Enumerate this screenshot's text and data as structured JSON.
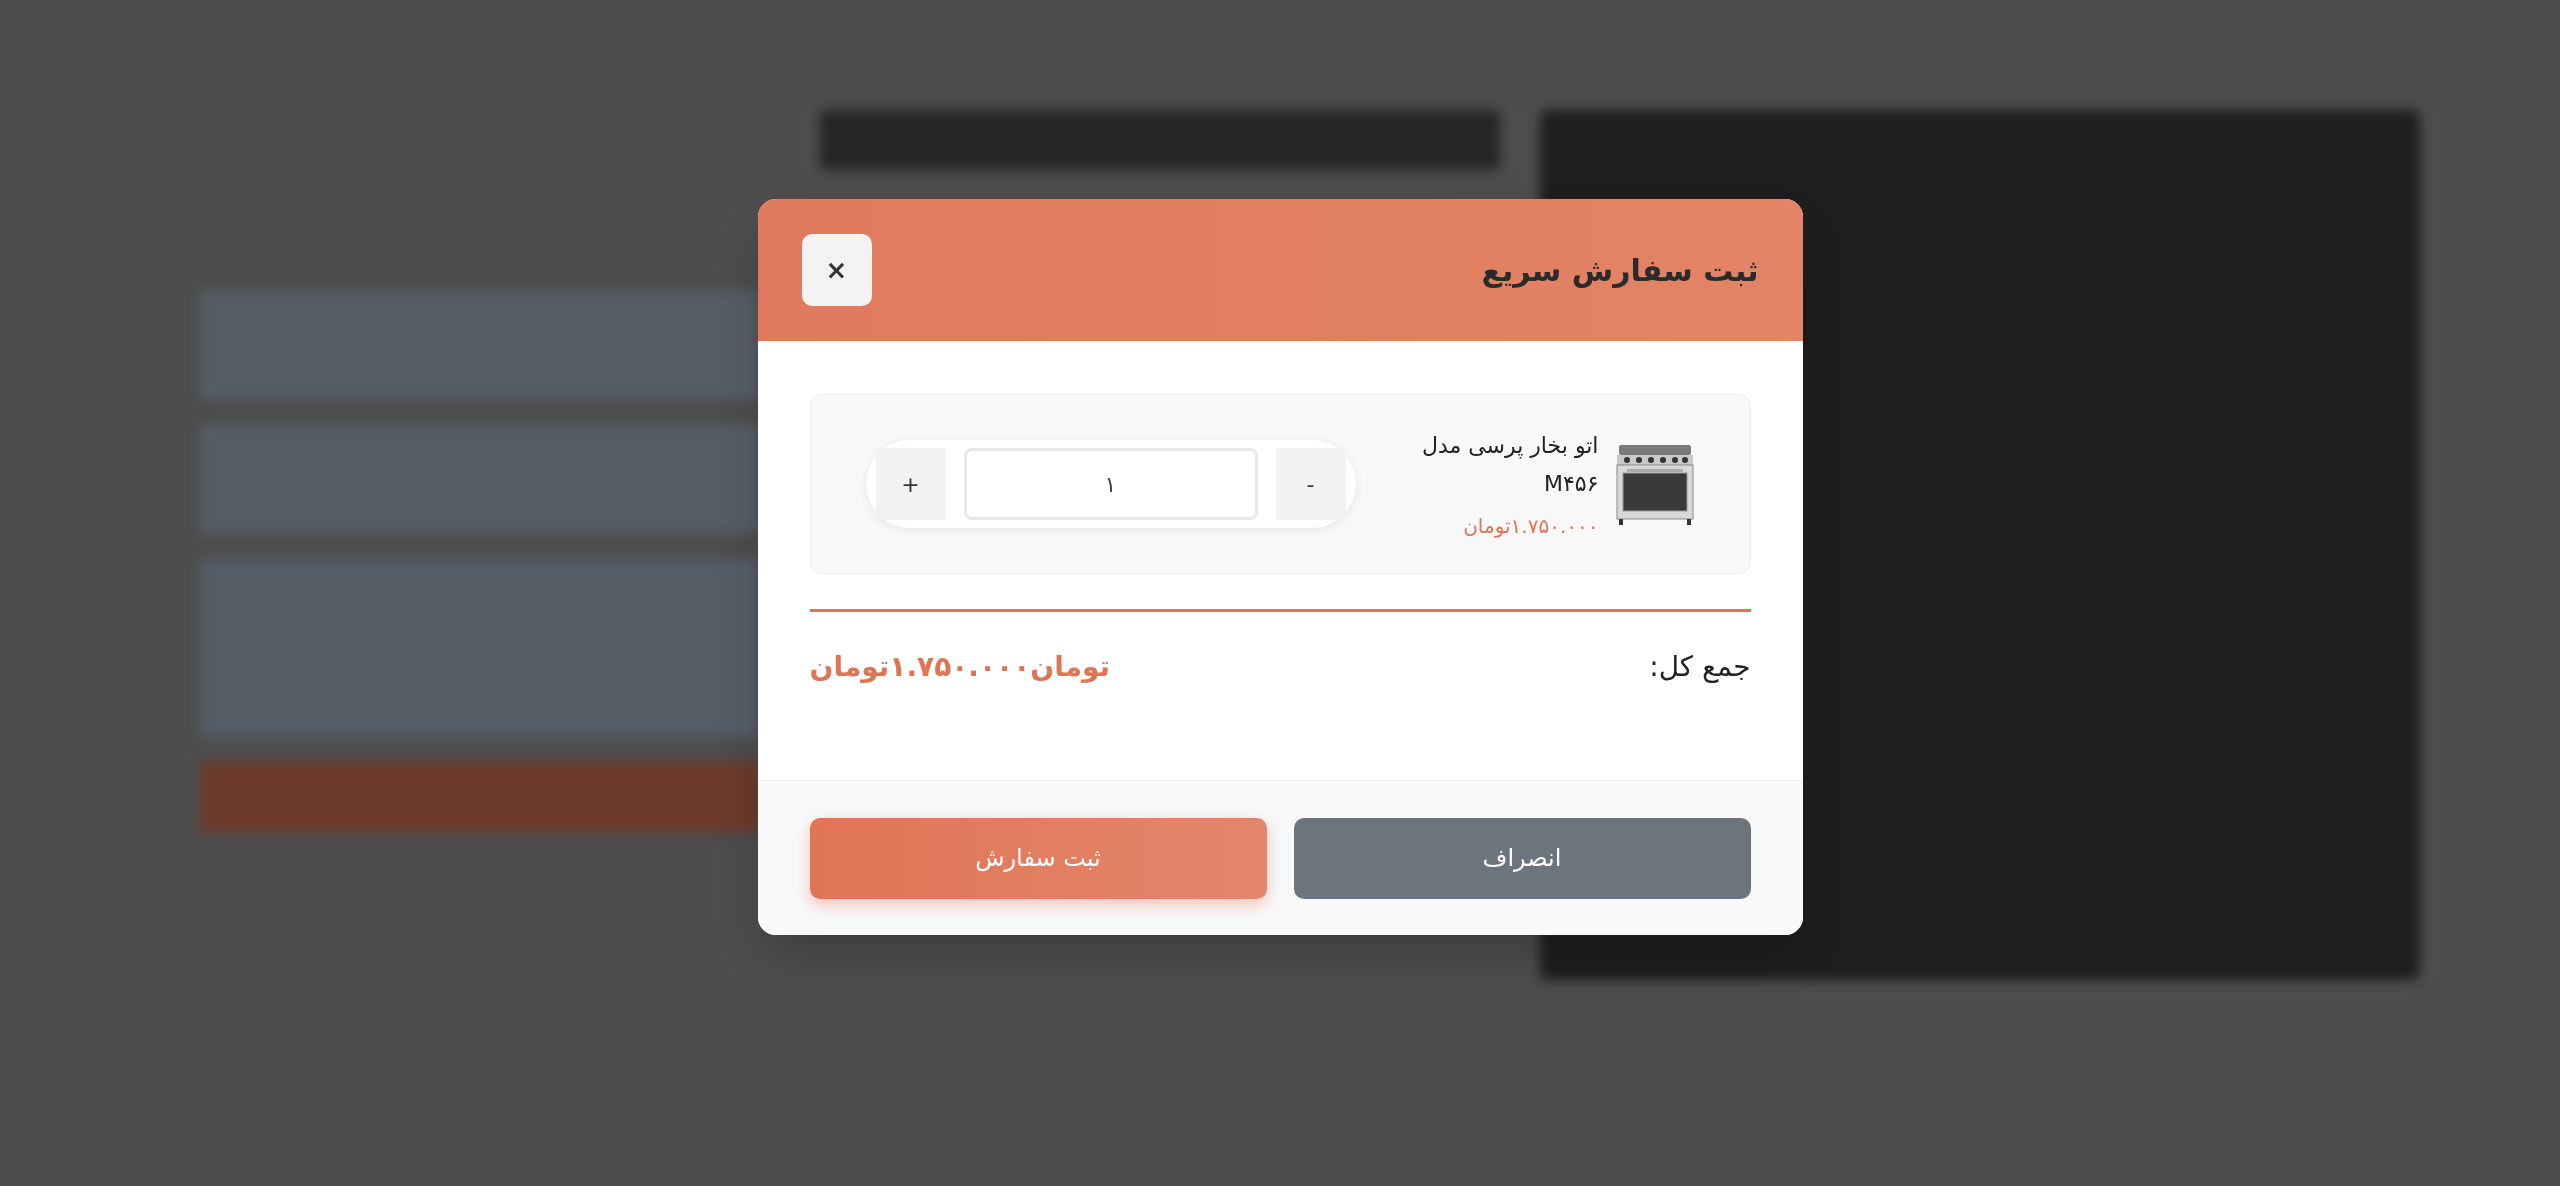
{
  "modal": {
    "title": "ثبت سفارش سریع",
    "close_label": "×",
    "item": {
      "name": "اتو بخار پرسی مدل M۴۵۶",
      "price": "۱.۷۵۰.۰۰۰تومان",
      "minus_label": "-",
      "plus_label": "+",
      "quantity": "۱"
    },
    "total": {
      "label": "جمع کل:",
      "value": "تومان۱.۷۵۰.۰۰۰تومان"
    },
    "buttons": [
      {
        "kind": "secondary",
        "label": "انصراف"
      },
      {
        "kind": "primary",
        "label": "ثبت سفارش"
      }
    ]
  }
}
